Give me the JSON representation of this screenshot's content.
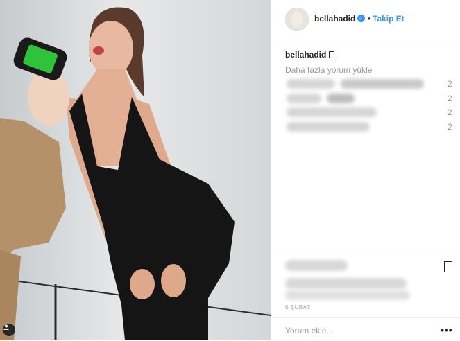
{
  "post": {
    "username": "bellahadid",
    "follow_label": "Takip Et",
    "separator": "•",
    "icons": [
      "verified-badge-icon",
      "bookmark-icon",
      "more-options-icon",
      "user-tag-icon"
    ],
    "accent_color": "#3897f0"
  },
  "caption": {
    "username": "bellahadid"
  },
  "comments": {
    "load_more_label": "Daha fazla yorum yükle",
    "rows": [
      {
        "time": "2"
      },
      {
        "time": "2"
      },
      {
        "time": "2"
      },
      {
        "time": "2"
      }
    ]
  },
  "footer": {
    "date_label": "6 ŞUBAT",
    "comment_placeholder": "Yorum ekle...",
    "more_label": "•••"
  }
}
